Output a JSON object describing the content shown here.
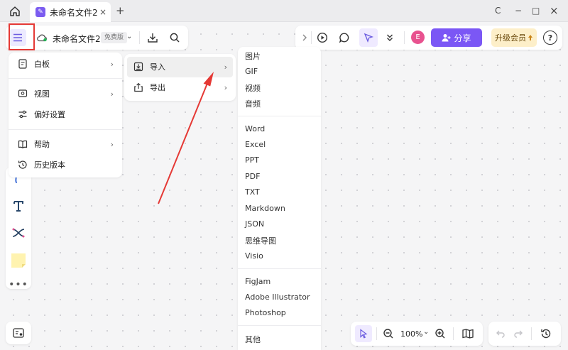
{
  "tabbar": {
    "tab_title": "未命名文件2",
    "tab_close": "×",
    "add_tab": "+",
    "win_refresh": "C",
    "win_min": "−",
    "win_max": "□",
    "win_close": "×"
  },
  "toolbar_left": {
    "file_name": "未命名文件2",
    "free_badge": "免费版",
    "dropdown": "⌄"
  },
  "toolbar_right": {
    "avatar_letter": "E",
    "share_label": "分享",
    "upgrade_label": "升级会员",
    "help": "?"
  },
  "main_menu": {
    "items": [
      {
        "label": "白板",
        "icon": "whiteboard-icon",
        "arrow": "›"
      },
      {
        "label": "视图",
        "icon": "view-icon",
        "arrow": "›"
      },
      {
        "label": "偏好设置",
        "icon": "settings-icon"
      },
      {
        "label": "帮助",
        "icon": "book-icon",
        "arrow": "›"
      },
      {
        "label": "历史版本",
        "icon": "history-icon"
      }
    ]
  },
  "sub_menu": {
    "items": [
      {
        "label": "导入",
        "icon": "import-icon",
        "arrow": "›"
      },
      {
        "label": "导出",
        "icon": "export-icon",
        "arrow": "›"
      }
    ]
  },
  "import_menu": {
    "group1": [
      "图片",
      "GIF",
      "视频",
      "音频"
    ],
    "group2": [
      "Word",
      "Excel",
      "PPT",
      "PDF",
      "TXT",
      "Markdown",
      "JSON",
      "思维导图",
      "Visio"
    ],
    "group3": [
      "FigJam",
      "Adobe Illustrator",
      "Photoshop"
    ],
    "group4": [
      "其他"
    ]
  },
  "zoom": {
    "level": "100%",
    "dropdown": "⌄"
  },
  "colors": {
    "accent": "#7b57f5",
    "highlight_box": "#e53935",
    "annotation_arrow": "#e53935",
    "upgrade_bg": "#fdefc9",
    "avatar": "#e8528f"
  }
}
